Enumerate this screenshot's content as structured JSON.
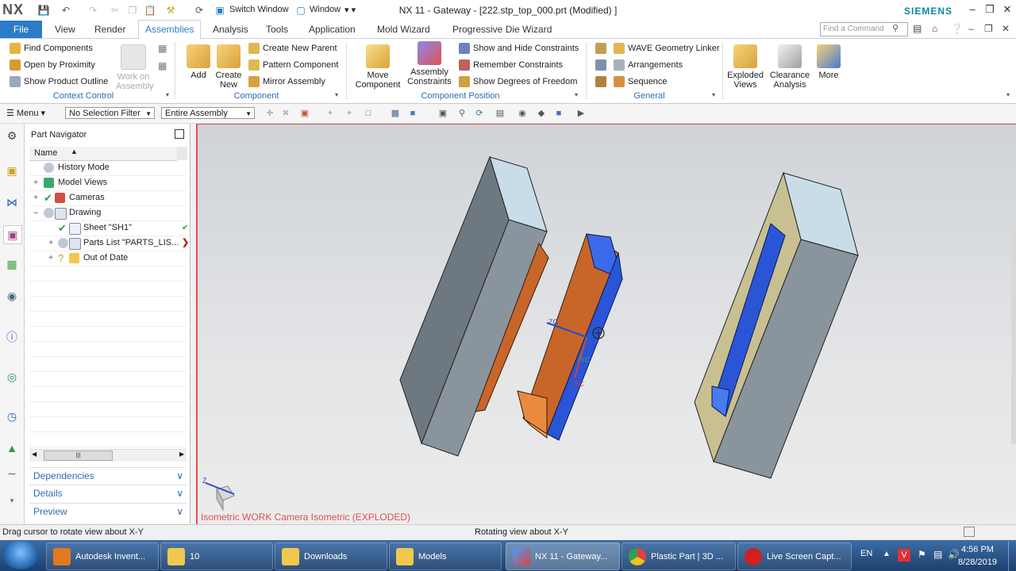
{
  "window": {
    "logo": "NX",
    "title": "NX 11 - Gateway - [222.stp_top_000.prt (Modified) ]",
    "brand": "SIEMENS",
    "switch_window": "Switch Window",
    "window_menu": "Window"
  },
  "menu": {
    "file": "File",
    "tabs": [
      "View",
      "Render",
      "Assemblies",
      "Analysis",
      "Tools",
      "Application",
      "Mold Wizard",
      "Progressive Die Wizard"
    ],
    "active_tab": "Assemblies",
    "find_placeholder": "Find a Command"
  },
  "ribbon": {
    "context_control": {
      "items": [
        "Find Components",
        "Open by Proximity",
        "Show Product Outline"
      ],
      "work_on_assembly": "Work on Assembly",
      "label": "Context Control"
    },
    "component": {
      "add": "Add",
      "create_new": "Create New",
      "items": [
        "Create New Parent",
        "Pattern Component",
        "Mirror Assembly"
      ],
      "label": "Component"
    },
    "component_position": {
      "move_component": "Move Component",
      "assembly_constraints": "Assembly Constraints",
      "items": [
        "Show and Hide Constraints",
        "Remember Constraints",
        "Show Degrees of Freedom"
      ],
      "label": "Component Position"
    },
    "general": {
      "items": [
        "WAVE Geometry Linker",
        "Arrangements",
        "Sequence"
      ],
      "label": "General"
    },
    "exploded_views": "Exploded Views",
    "clearance_analysis": "Clearance Analysis",
    "more": "More"
  },
  "selection_bar": {
    "menu": "Menu",
    "filter": "No Selection Filter",
    "scope": "Entire Assembly"
  },
  "part_navigator": {
    "title": "Part Navigator",
    "column": "Name",
    "rows": [
      {
        "label": "History Mode",
        "indent": 0
      },
      {
        "label": "Model Views",
        "indent": 0
      },
      {
        "label": "Cameras",
        "indent": 0
      },
      {
        "label": "Drawing",
        "indent": 0
      },
      {
        "label": "Sheet \"SH1\"",
        "indent": 1
      },
      {
        "label": "Parts List \"PARTS_LIS...",
        "indent": 1
      },
      {
        "label": "Out of Date",
        "indent": 1
      }
    ],
    "panels": [
      "Dependencies",
      "Details",
      "Preview"
    ]
  },
  "graphics": {
    "view_label": "Isometric WORK Camera Isometric (EXPLODED)",
    "axis_labels": {
      "z": "Z",
      "zc": "ZC",
      "yc": "YC",
      "xc": "XC"
    }
  },
  "status": {
    "left": "Drag cursor to rotate view about X-Y",
    "center": "Rotating view about X-Y"
  },
  "taskbar": {
    "tasks": [
      "Autodesk Invent...",
      "10",
      "Downloads",
      "Models",
      "NX 11 - Gateway...",
      "Plastic Part | 3D ...",
      "Live Screen Capt..."
    ],
    "lang": "EN",
    "time": "4:56 PM",
    "date": "8/28/2019"
  },
  "colors": {
    "accent": "#2a7cc7",
    "brand": "#0f8a96",
    "view_label": "#d9534f",
    "part_blue": "#2a55d6",
    "part_orange": "#c8662a",
    "block_grey": "#8a949c"
  }
}
